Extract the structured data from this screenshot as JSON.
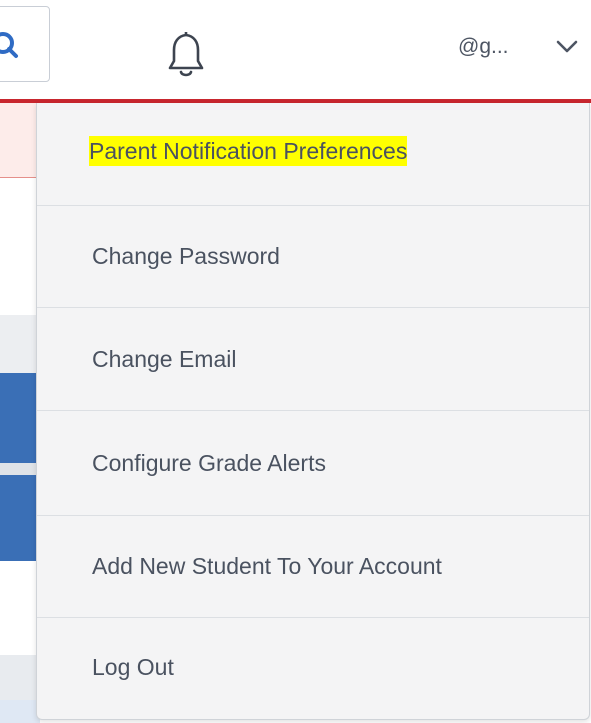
{
  "header": {
    "user_label": "@g...",
    "icons": {
      "search": "search-icon",
      "bell": "bell-icon",
      "chevron": "chevron-down-icon"
    }
  },
  "colors": {
    "accent_line": "#c8262e",
    "highlight": "#ffff00",
    "menu_bg": "#f4f4f5",
    "text": "#4a5260",
    "page_blue": "#3a6fb6"
  },
  "menu": {
    "items": [
      {
        "label": "Parent Notification Preferences",
        "highlighted": true
      },
      {
        "label": "Change Password",
        "highlighted": false
      },
      {
        "label": "Change Email",
        "highlighted": false
      },
      {
        "label": "Configure Grade Alerts",
        "highlighted": false
      },
      {
        "label": "Add New Student To Your Account",
        "highlighted": false
      },
      {
        "label": "Log Out",
        "highlighted": false
      }
    ]
  }
}
